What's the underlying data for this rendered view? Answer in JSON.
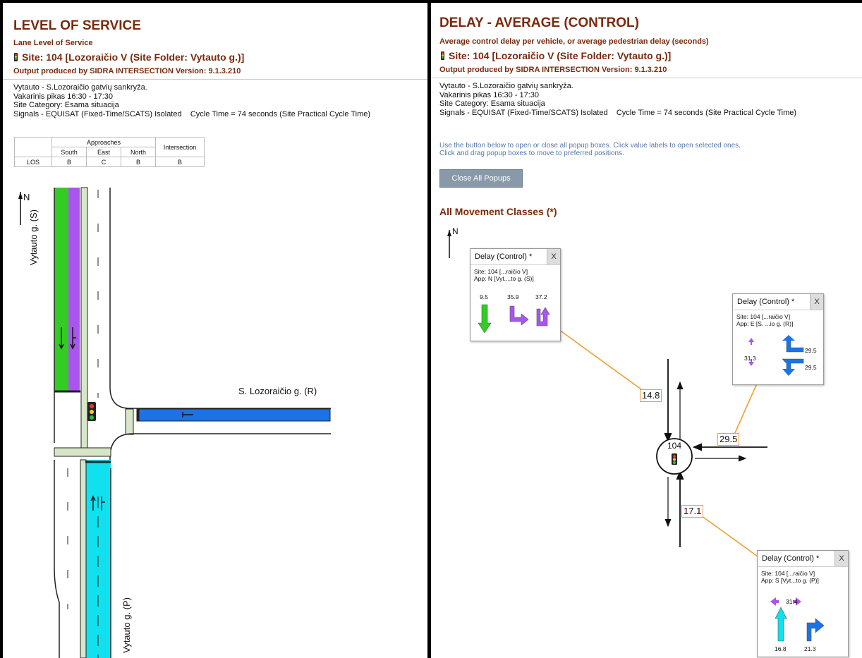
{
  "left": {
    "title": "LEVEL OF SERVICE",
    "subtitle": "Lane Level of Service",
    "site": "Site: 104 [Lozoraičio V (Site Folder: Vytauto g.)]",
    "output": "Output produced by SIDRA INTERSECTION Version: 9.1.3.210",
    "info": [
      "Vytauto - S.Lozoraičio gatvių sankryža.",
      "Vakarinis pikas 16:30 - 17:30",
      "Site Category: Esama situacija",
      "Signals - EQUISAT (Fixed-Time/SCATS) Isolated    Cycle Time = 74 seconds (Site Practical Cycle Time)"
    ],
    "table": {
      "approaches_header": "Approaches",
      "intersection_header": "Intersection",
      "columns": [
        "South",
        "East",
        "North"
      ],
      "row_label": "LOS",
      "values": [
        "B",
        "C",
        "B"
      ],
      "intersection_value": "B"
    },
    "map": {
      "north_label": "N",
      "north_road": "Vytauto g. (S)",
      "east_road": "S. Lozoraičio g. (R)",
      "south_road": "Vytauto g. (P)",
      "colors": {
        "north_through": "#33cc22",
        "north_right": "#aa55ee",
        "east": "#1a73e8",
        "south": "#11e0ee"
      }
    }
  },
  "right": {
    "title": "DELAY - AVERAGE (CONTROL)",
    "subtitle": "Average control delay per vehicle, or average pedestrian delay (seconds)",
    "site": "Site: 104 [Lozoraičio V (Site Folder: Vytauto g.)]",
    "output": "Output produced by SIDRA INTERSECTION Version: 9.1.3.210",
    "info": [
      "Vytauto - S.Lozoraičio gatvių sankryža.",
      "Vakarinis pikas 16:30 - 17:30",
      "Site Category: Esama situacija",
      "Signals - EQUISAT (Fixed-Time/SCATS) Isolated    Cycle Time = 74 seconds (Site Practical Cycle Time)"
    ],
    "note": [
      "Use the button below to open or close all popup boxes. Click value labels to open selected ones.",
      "Click and drag popup boxes to move to preferred positions."
    ],
    "button": "Close All Popups",
    "section": "All Movement Classes (*)",
    "north_label": "N",
    "node_id": "104",
    "labels": {
      "north": "14.8",
      "east": "29.5",
      "south": "17.1"
    },
    "popups": {
      "north": {
        "title": "Delay (Control) *",
        "close": "X",
        "site": "Site: 104 [...raičio V]",
        "app": "App: N [Vyt....to g. (S)]",
        "values": [
          "9.5",
          "35.9",
          "37.2"
        ]
      },
      "east": {
        "title": "Delay (Control) *",
        "close": "X",
        "site": "Site: 104 [...raičio V]",
        "app": "App: E [S. ...io g. (R)]",
        "ped": "31.3",
        "values": [
          "29.5",
          "29.5"
        ]
      },
      "south": {
        "title": "Delay (Control) *",
        "close": "X",
        "site": "Site: 104 [...raičio V]",
        "app": "App: S [Vyt...to g. (P)]",
        "ped": "31.4",
        "values": [
          "16.8",
          "21.3"
        ]
      }
    }
  }
}
